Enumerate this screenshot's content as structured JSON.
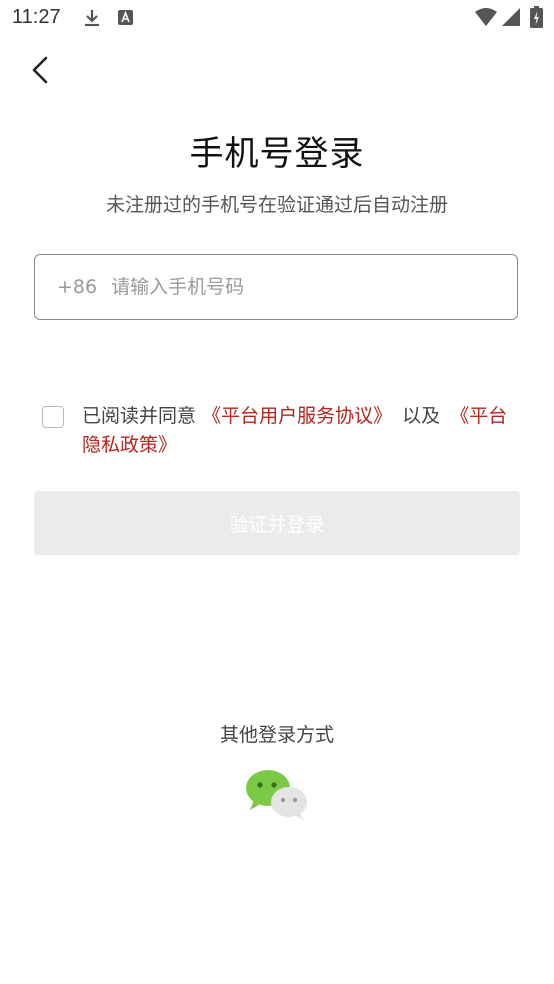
{
  "status_bar": {
    "time": "11:27",
    "icons": [
      "download-icon",
      "a-icon",
      "wifi-icon",
      "signal-icon",
      "battery-icon"
    ]
  },
  "nav": {
    "back_icon": "chevron-left-icon"
  },
  "header": {
    "title": "手机号登录",
    "subtitle": "未注册过的手机号在验证通过后自动注册"
  },
  "phone": {
    "country_code": "+86",
    "placeholder": "请输入手机号码",
    "value": ""
  },
  "agreement": {
    "checked": false,
    "prefix": "已阅读并同意",
    "user_agreement": "《平台用户服务协议》",
    "conjunction": "以及",
    "privacy_policy": "《平台隐私政策》"
  },
  "submit": {
    "label": "验证并登录",
    "enabled": false
  },
  "other_login": {
    "label": "其他登录方式",
    "icon": "wechat-icon"
  },
  "colors": {
    "link": "#b3261e",
    "disabled_button_bg": "#ebebeb",
    "wechat_green": "#7bc947"
  }
}
